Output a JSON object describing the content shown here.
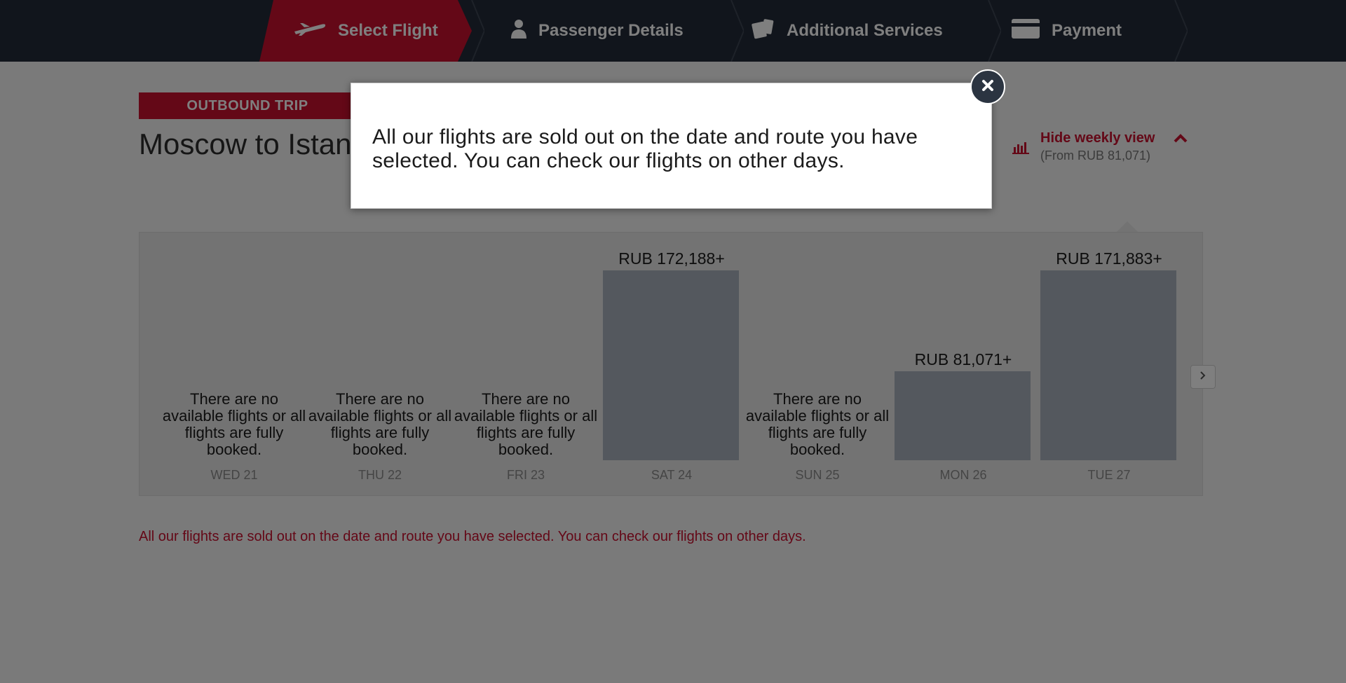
{
  "steps": [
    {
      "label": "Select Flight",
      "icon": "plane-icon",
      "active": true
    },
    {
      "label": "Passenger Details",
      "icon": "person-icon",
      "active": false
    },
    {
      "label": "Additional Services",
      "icon": "tickets-icon",
      "active": false
    },
    {
      "label": "Payment",
      "icon": "card-icon",
      "active": false
    }
  ],
  "trip": {
    "badge": "OUTBOUND TRIP",
    "route": "Moscow to Istanbul"
  },
  "weekly": {
    "label": "Hide weekly view",
    "sub": "(From RUB 81,071)",
    "icon": "bar-chart-icon"
  },
  "week": {
    "no_flights_text": "There are no available flights or all flights are fully booked.",
    "days": [
      {
        "label": "WED 21",
        "price": null,
        "level": 0
      },
      {
        "label": "THU 22",
        "price": null,
        "level": 0
      },
      {
        "label": "FRI 23",
        "price": null,
        "level": 0
      },
      {
        "label": "SAT 24",
        "price": "RUB 172,188+",
        "level": 1.0
      },
      {
        "label": "SUN 25",
        "price": null,
        "level": 0
      },
      {
        "label": "MON 26",
        "price": "RUB 81,071+",
        "level": 0.47
      },
      {
        "label": "TUE 27",
        "price": "RUB 171,883+",
        "level": 1.0
      }
    ]
  },
  "sold_out_message": "All our flights are sold out on the date and route you have selected. You can check our flights on other days.",
  "modal": {
    "text": "All our flights are sold out on the date and route you have selected. You can check our flights on other days."
  },
  "colors": {
    "brand_red": "#c8102e",
    "dark_nav": "#232b38"
  }
}
